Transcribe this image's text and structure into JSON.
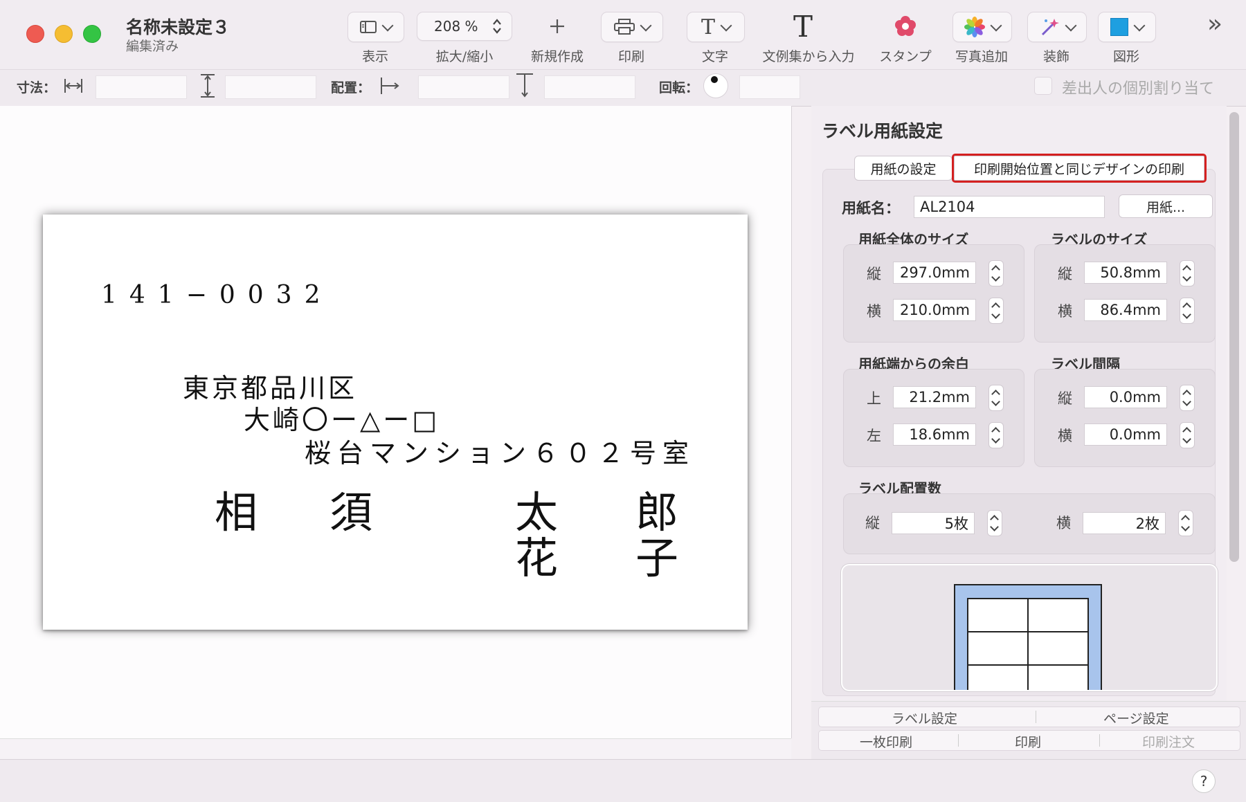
{
  "window": {
    "title": "名称未設定３",
    "subtitle": "編集済み"
  },
  "toolbar": {
    "view_label": "表示",
    "zoom_value": "208 %",
    "zoom_label": "拡大/縮小",
    "new_label": "新規作成",
    "print_label": "印刷",
    "text_label": "文字",
    "template_label": "文例集から入力",
    "stamp_label": "スタンプ",
    "photo_label": "写真追加",
    "decor_label": "装飾",
    "shape_label": "図形",
    "more_icon": "»"
  },
  "measure": {
    "size_label": "寸法：",
    "position_label": "配置：",
    "rotate_label": "回転：",
    "per_sender_label": "差出人の個別割り当て"
  },
  "label_card": {
    "postal": "141−0032",
    "address_line1": "東京都品川区",
    "address_line2": "大崎〇ー△ー□",
    "address_line3": "桜台マンション６０２号室",
    "surname": "相須",
    "given_name1": "太郎",
    "given_name2": "花子"
  },
  "panel": {
    "title": "ラベル用紙設定",
    "tab_paper": "用紙の設定",
    "tab_same_design": "印刷開始位置と同じデザインの印刷",
    "paper_name_label": "用紙名：",
    "paper_name_value": "AL2104",
    "paper_button": "用紙...",
    "group_sheet_size": "用紙全体のサイズ",
    "group_label_size": "ラベルのサイズ",
    "group_margin": "用紙端からの余白",
    "group_gap": "ラベル間隔",
    "group_count": "ラベル配置数",
    "lbl_vertical": "縦",
    "lbl_horizontal": "横",
    "lbl_top": "上",
    "lbl_left": "左",
    "sheet_height": "297.0mm",
    "sheet_width": "210.0mm",
    "label_height": "50.8mm",
    "label_width": "86.4mm",
    "margin_top": "21.2mm",
    "margin_left": "18.6mm",
    "gap_vertical": "0.0mm",
    "gap_horizontal": "0.0mm",
    "count_vertical": "5枚",
    "count_horizontal": "2枚"
  },
  "bottom": {
    "label_settings": "ラベル設定",
    "page_settings": "ページ設定",
    "single_print": "一枚印刷",
    "print": "印刷",
    "print_order": "印刷注文"
  },
  "help": "?",
  "colors": {
    "highlight": "#d42020",
    "preview_sheet": "#a8c4ec"
  }
}
